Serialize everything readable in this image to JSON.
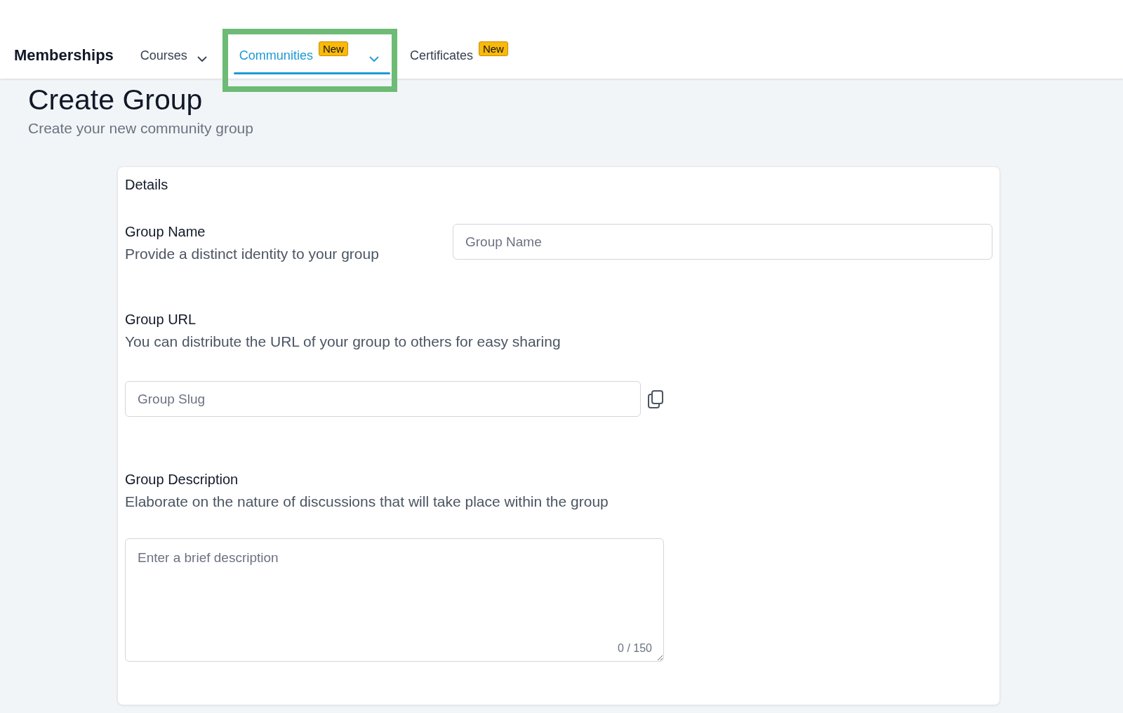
{
  "nav": {
    "brand": "Memberships",
    "tabs": [
      {
        "label": "Courses",
        "selected": false,
        "dropdown": true,
        "highlighted": false
      },
      {
        "label": "Communities",
        "selected": true,
        "dropdown": true,
        "badge": "New",
        "highlighted": true
      },
      {
        "label": "Certificates",
        "selected": false,
        "dropdown": false,
        "badge": "New",
        "highlighted": false
      }
    ]
  },
  "page": {
    "title": "Create Group",
    "subtitle": "Create your new community group"
  },
  "card": {
    "title": "Details",
    "sections": [
      {
        "kind": "inline",
        "label": "Group Name",
        "hint": "Provide a distinct identity to your group",
        "placeholder": "Group Name"
      },
      {
        "kind": "copy",
        "label": "Group URL",
        "hint": "You can distribute the URL of your group to others for easy sharing",
        "placeholder": "Group Slug"
      },
      {
        "kind": "textarea",
        "label": "Group Description",
        "hint": "Elaborate on the nature of discussions that will take place within the group",
        "placeholder": "Enter a brief description",
        "counter": "0 / 150"
      }
    ]
  }
}
